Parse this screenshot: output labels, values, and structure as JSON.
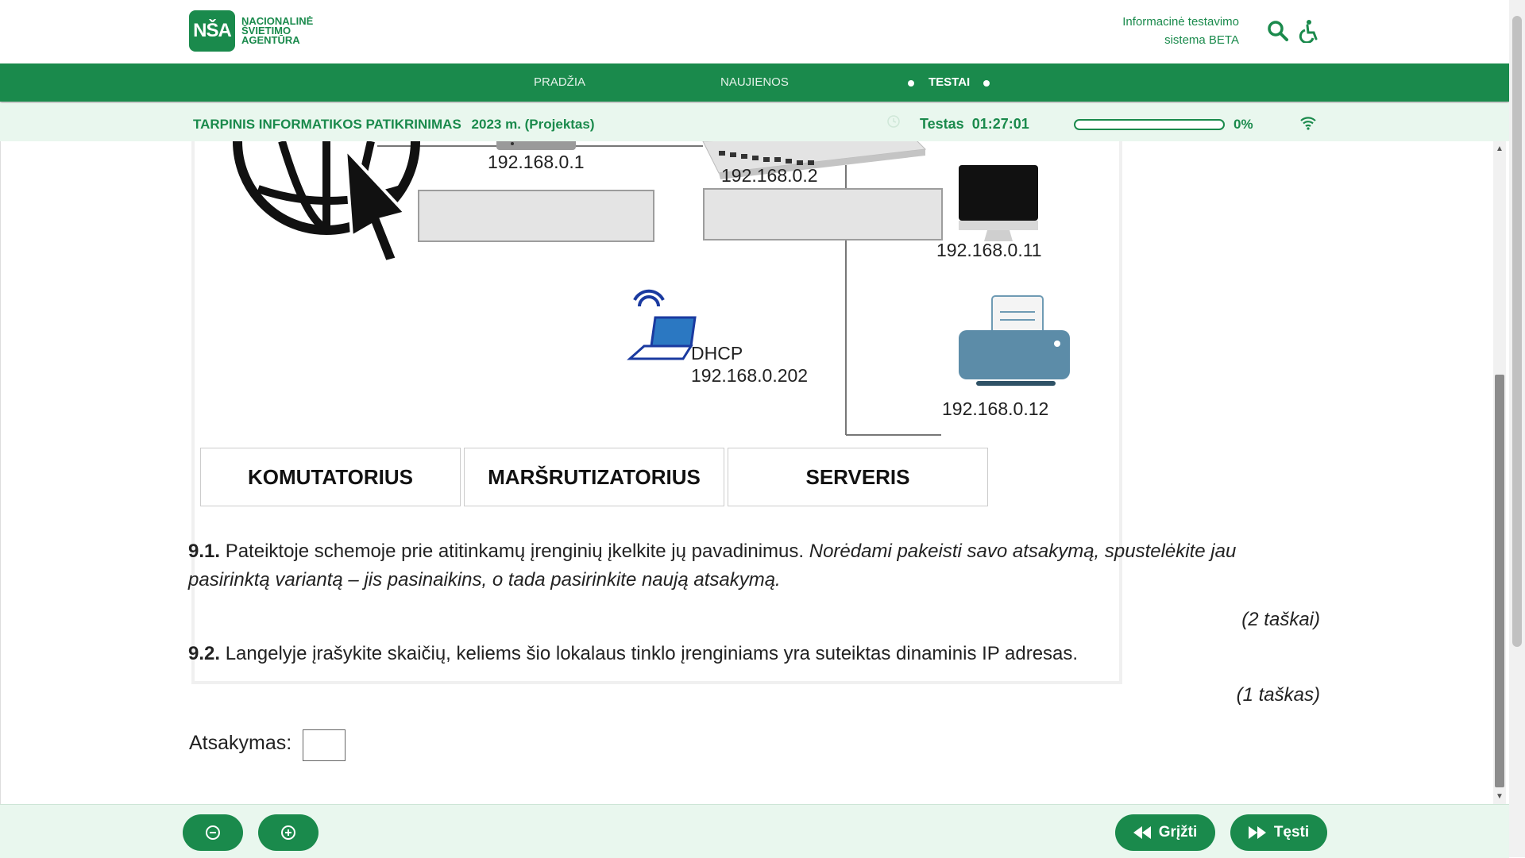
{
  "header": {
    "logo_mark": "NŠA",
    "logo_text": [
      "NACIONALINĖ",
      "ŠVIETIMO",
      "AGENTŪRA"
    ],
    "system_name_line1": "Informacinė testavimo",
    "system_name_line2": "sistema BETA"
  },
  "nav": {
    "items": [
      {
        "label": "PRADŽIA"
      },
      {
        "label": "NAUJIENOS"
      },
      {
        "label": "TESTAI"
      }
    ]
  },
  "status": {
    "exam_title": "TARPINIS INFORMATIKOS PATIKRINIMAS",
    "exam_year": "2023 m. (Projektas)",
    "timer_label": "Testas",
    "timer_value": "01:27:01",
    "progress_percent": "0%",
    "progress_value": 0
  },
  "diagram": {
    "ips": {
      "router": "192.168.0.1",
      "switch": "192.168.0.2",
      "computer": "192.168.0.11",
      "laptop_dhcp": "DHCP",
      "laptop": "192.168.0.202",
      "printer": "192.168.0.12"
    },
    "cards": [
      "KOMUTATORIUS",
      "MARŠRUTIZATORIUS",
      "SERVERIS"
    ]
  },
  "questions": {
    "q1_number": "9.1.",
    "q1_text": " Pateiktoje schemoje prie atitinkamų įrenginių įkelkite jų pavadinimus. ",
    "q1_italic": "Norėdami pakeisti savo atsakymą, spustelėkite jau pasirinktą variantą – jis pasinaikins, o tada pasirinkite naują atsakymą.",
    "q1_points": "(2 taškai)",
    "q2_number": "9.2.",
    "q2_text": " Langelyje įrašykite skaičių, keliems šio lokalaus tinklo įrenginiams yra suteiktas dinaminis IP adresas.",
    "q2_points": "(1 taškas)",
    "answer_label": "Atsakymas:",
    "answer_value": ""
  },
  "footer": {
    "back_label": "Grįžti",
    "next_label": "Tęsti"
  },
  "colors": {
    "brand": "#1a8a4c",
    "status_bg": "#e9f7ee"
  }
}
